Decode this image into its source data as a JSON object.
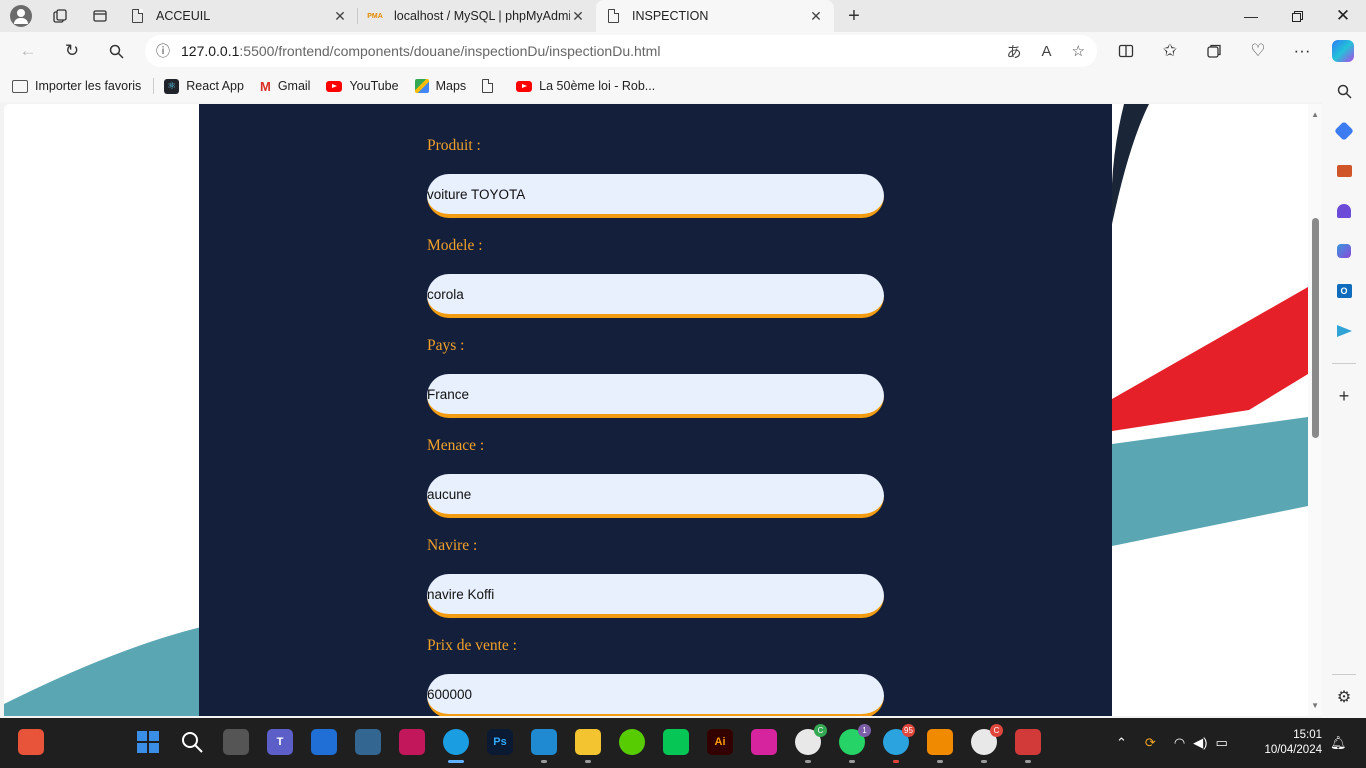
{
  "browser": {
    "tabs": [
      {
        "title": "ACCEUIL",
        "icon": "document-icon"
      },
      {
        "title": "localhost / MySQL | phpMyAdmi",
        "icon": "phpmyadmin-icon",
        "icon_text": "PMA"
      },
      {
        "title": "INSPECTION",
        "icon": "document-icon",
        "active": true
      }
    ],
    "url": {
      "host": "127.0.0.1",
      "path": ":5500/frontend/components/douane/inspectionDu/inspectionDu.html"
    },
    "bookmarks": [
      {
        "label": "Importer les favoris",
        "icon": "import-favorites-icon"
      },
      {
        "label": "React App",
        "icon": "react-icon"
      },
      {
        "label": "Gmail",
        "icon": "gmail-icon",
        "icon_text": "M"
      },
      {
        "label": "YouTube",
        "icon": "youtube-icon"
      },
      {
        "label": "Maps",
        "icon": "maps-icon"
      },
      {
        "label": "",
        "icon": "document-icon"
      },
      {
        "label": "La 50ème loi - Rob...",
        "icon": "youtube-icon"
      }
    ]
  },
  "form": {
    "fields": [
      {
        "label": "Produit :",
        "value": "voiture TOYOTA"
      },
      {
        "label": "Modele :",
        "value": "corola"
      },
      {
        "label": "Pays :",
        "value": "France"
      },
      {
        "label": "Menace :",
        "value": "aucune"
      },
      {
        "label": "Navire :",
        "value": "navire Koffi"
      },
      {
        "label": "Prix de vente :",
        "value": "600000"
      }
    ]
  },
  "taskbar": {
    "apps": [
      {
        "name": "winget-icon",
        "color": "#e8543a"
      },
      {
        "name": "windows-start-icon",
        "color": "#3a8ee6"
      },
      {
        "name": "search-icon",
        "color": "#1f1f1f"
      },
      {
        "name": "task-view-icon",
        "color": "#555"
      },
      {
        "name": "teams-icon",
        "color": "#5b5fc7",
        "text": "T"
      },
      {
        "name": "store-icon",
        "color": "#1f6fd6"
      },
      {
        "name": "pgadmin-icon",
        "color": "#336791"
      },
      {
        "name": "wamp-icon",
        "color": "#c2185b"
      },
      {
        "name": "edge-icon",
        "color": "#1b9de2",
        "active": true
      },
      {
        "name": "photoshop-icon",
        "color": "#0b1a33",
        "text": "Ps"
      },
      {
        "name": "vscode-icon",
        "color": "#1f8ad2"
      },
      {
        "name": "file-explorer-icon",
        "color": "#f4c430"
      },
      {
        "name": "duolingo-icon",
        "color": "#58cc02"
      },
      {
        "name": "line-icon",
        "color": "#06c755"
      },
      {
        "name": "illustrator-icon",
        "color": "#330000",
        "text": "Ai"
      },
      {
        "name": "instagram-icon",
        "color": "#d6249f"
      },
      {
        "name": "chrome-icon",
        "color": "#e8e8e8",
        "badge": "C"
      },
      {
        "name": "whatsapp-icon",
        "color": "#25d366",
        "badge": "1"
      },
      {
        "name": "telegram-icon",
        "color": "#2aa3df",
        "badge": "95"
      },
      {
        "name": "vlc-icon",
        "color": "#f08a00"
      },
      {
        "name": "chrome-profile-icon",
        "color": "#e8e8e8",
        "badge": "C"
      },
      {
        "name": "snipping-tool-icon",
        "color": "#d23a3a"
      }
    ],
    "time": "15:01",
    "date": "10/04/2024"
  }
}
